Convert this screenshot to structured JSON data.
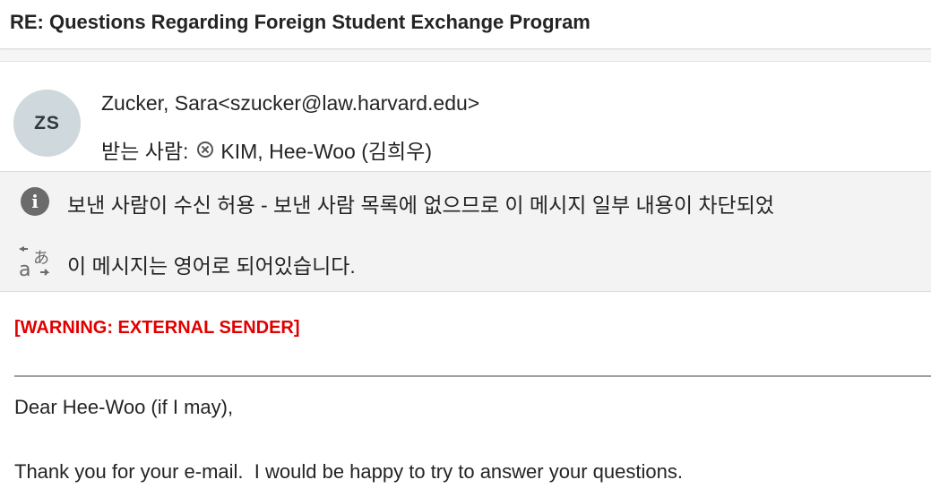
{
  "email": {
    "subject": "RE: Questions Regarding Foreign Student Exchange Program",
    "avatar_initials": "ZS",
    "sender": "Zucker, Sara<szucker@law.harvard.edu>",
    "to_label": "받는 사람:",
    "recipient": "KIM, Hee-Woo (김희우)"
  },
  "notices": {
    "blocked_content": "보낸 사람이 수신 허용 - 보낸 사람 목록에 없으므로 이 메시지 일부 내용이 차단되었",
    "translation": "이 메시지는 영어로 되어있습니다."
  },
  "body": {
    "warning": "[WARNING: EXTERNAL SENDER]",
    "greeting": "Dear Hee-Woo (if I may),",
    "paragraph1": "Thank you for your e-mail.  I would be happy to try to answer your questions."
  },
  "icons": {
    "info": "info-icon",
    "translate": "translate-icon",
    "remove_recipient": "close-circle-icon"
  },
  "colors": {
    "warning": "#e00000",
    "avatar_bg": "#cfd8dc",
    "notice_bg": "#f3f3f3"
  }
}
